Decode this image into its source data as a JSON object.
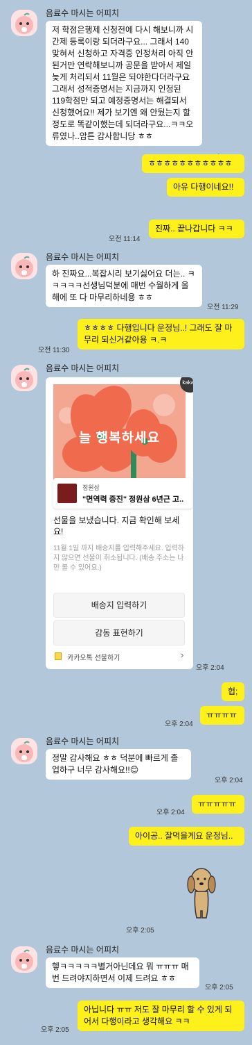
{
  "sender_name": "음료수 마시는 어피치",
  "messages": {
    "m1": "저 학점은행제 신청전에 다시 해보니까 시간제 등록이랑 되더라구요... 그래서 140맞혀서 신청하고 자격증 인정처리 아직 안된거만 연락해보니까 공문을 받아서 제일 늦게 처리되서 11월은 되야한다더라구요 그래서 성적증명서는 지금까지 인정된 119학점만 되고 예정증명서는 해결되서 신청했어요!! 제가 보기엔 왜 안뒀는지 할정도로 똑같이했는데 되더라구요...ㅋㅋ오류였나..암튼 감사합니당 ㅎㅎ",
    "t1": "오전 11:11",
    "m2": "ㅎㅎㅎㅎㅎㅎㅎㅎㅎㅎㅎ",
    "m3": "아유 다행이네요!!",
    "m4": "진짜.. 끝나갑니다 ㅋㅋ",
    "t4": "오전 11:14",
    "m5": "하 진짜요...복잡시리 보기싫어요 더는.. ㅋㅋㅋㅋㅋ선생님덕분에 매번 수월하게 올해에 또 다 마무리하네용 ㅎㅎ",
    "t5": "오전 11:29",
    "m6": "ㅎㅎㅎㅎ 다행입니다 운정님..! 그래도 잘 마무리 되신거같아용 ㅋ.ㅋ",
    "t6": "오전 11:30",
    "gift": {
      "kakao_badge": "kakao",
      "banner_text": "늘 행복하세요",
      "brand": "정원삼",
      "product": "\"면역력 증진\" 정원삼 6년근 고..",
      "title": "선물을 보냈습니다. 지금 확인해 보세요!",
      "note": "11월 1일 까지 배송지를 입력해주세요. 입력하지 않으면 선물이 취소됩니다. (배송 주소는 나만 볼 수 있어요.)",
      "btn_address": "배송지 입력하기",
      "btn_thanks": "감동 표현하기",
      "footer": "카카오톡 선물하기"
    },
    "t7": "오후 2:04",
    "m8": "헙;",
    "m9": "ㅠㅠㅠㅠ",
    "t9": "오후 2:04",
    "m10": "정말 감사해요 ㅎㅎ 덕분에 빠르게 졸업하구 너무 감사해요!!😊",
    "t10": "오후 2:04",
    "m11": "ㅠㅠㅠㅠㅠ",
    "t11": "오후 2:04",
    "m12": "아이공.. 잘먹을게요 운정님..",
    "t13": "오후 2:05",
    "m14": "헿ㅋㅋㅋㅋㅋ별거아닌데요 뭐 ㅠㅠㅠ 매번 드려야지하면서 이제 드려요 ㅎㅎ",
    "t14": "오후 2:05",
    "m15": "아닙니다 ㅠㅠ 저도 잘 마무리 할 수 있게 되어서 다행이라고 생각해요 ㅋㅋ",
    "t15": "오후 2:05"
  },
  "colors": {
    "background": "#b2c7d9",
    "outgoing": "#fef01b",
    "incoming": "#ffffff",
    "banner": "#f6a08a"
  }
}
